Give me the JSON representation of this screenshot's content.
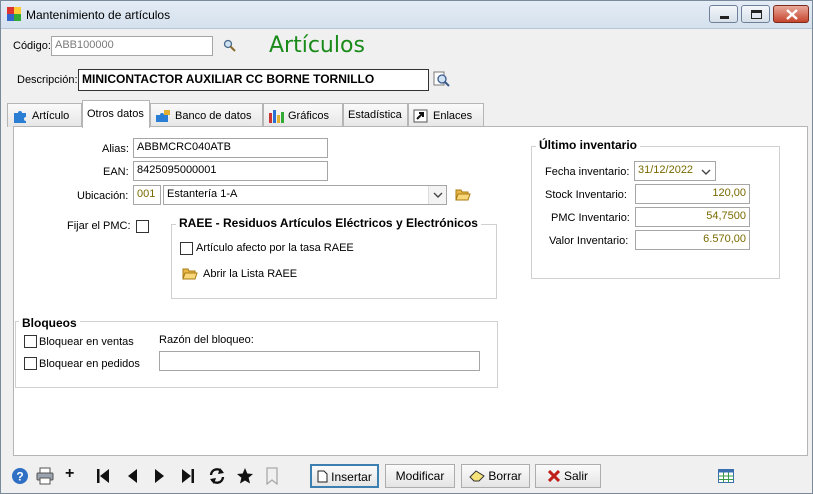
{
  "window": {
    "title": "Mantenimiento de artículos"
  },
  "header": {
    "codigo_label": "Código:",
    "codigo_value": "ABB100000",
    "big_title": "Artículos",
    "descripcion_label": "Descripción:",
    "descripcion_value": "MINICONTACTOR AUXILIAR CC BORNE TORNILLO"
  },
  "tabs": [
    {
      "label": "Artículo"
    },
    {
      "label": "Otros datos"
    },
    {
      "label": "Banco de datos"
    },
    {
      "label": "Gráficos"
    },
    {
      "label": "Estadística"
    },
    {
      "label": "Enlaces"
    }
  ],
  "otros": {
    "alias_label": "Alias:",
    "alias_value": "ABBMCRC040ATB",
    "ean_label": "EAN:",
    "ean_value": "8425095000001",
    "ubicacion_label": "Ubicación:",
    "ubicacion_code": "001",
    "ubicacion_value": "Estantería 1-A",
    "fijar_pmc_label": "Fijar el PMC:"
  },
  "raee": {
    "title": "RAEE - Residuos Artículos Eléctricos y Electrónicos",
    "afecto_label": "Artículo afecto por la tasa RAEE",
    "abrir_label": "Abrir la Lista RAEE"
  },
  "inventario": {
    "title": "Último inventario",
    "fecha_label": "Fecha inventario:",
    "fecha_value": "31/12/2022",
    "stock_label": "Stock Inventario:",
    "stock_value": "120,00",
    "pmc_label": "PMC Inventario:",
    "pmc_value": "54,7500",
    "valor_label": "Valor Inventario:",
    "valor_value": "6.570,00"
  },
  "bloqueos": {
    "title": "Bloqueos",
    "ventas_label": "Bloquear en ventas",
    "pedidos_label": "Bloquear en pedidos",
    "razon_label": "Razón del bloqueo:",
    "razon_value": ""
  },
  "toolbar": {
    "plus": "+",
    "insertar": "Insertar",
    "modificar": "Modificar",
    "borrar": "Borrar",
    "salir": "Salir"
  },
  "colors": {
    "title_green": "#1a8a1a",
    "gold_text": "#7a6a00",
    "close_red": "#c4442b"
  }
}
